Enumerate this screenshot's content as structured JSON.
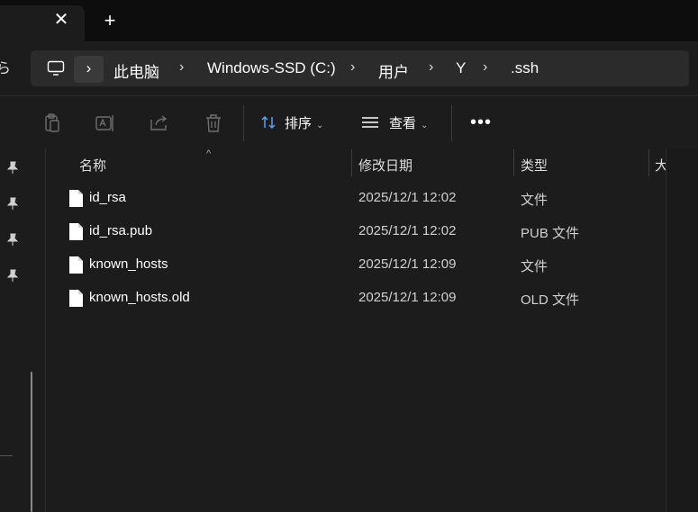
{
  "tab_bar": {
    "close_glyph": "✕",
    "new_tab_glyph": "+"
  },
  "address": {
    "edge_glyph": "ら",
    "chevron_glyph": "›",
    "crumbs": [
      "此电脑",
      "Windows-SSD (C:)",
      "用户",
      "Y",
      ".ssh"
    ]
  },
  "toolbar": {
    "icons": [
      "paste-icon",
      "rename-icon",
      "share-icon",
      "delete-icon"
    ],
    "sort_label": "排序",
    "view_label": "查看",
    "more_label": "•••"
  },
  "nav": {
    "pinned_icons": [
      "pin-icon",
      "pin-icon",
      "pin-icon",
      "pin-icon"
    ]
  },
  "columns": {
    "sort_indicator": "^",
    "name": "名称",
    "date": "修改日期",
    "type": "类型",
    "size_clipped": "大"
  },
  "files": [
    {
      "name": "id_rsa",
      "date": "2025/12/1 12:02",
      "type": "文件"
    },
    {
      "name": "id_rsa.pub",
      "date": "2025/12/1 12:02",
      "type": "PUB 文件"
    },
    {
      "name": "known_hosts",
      "date": "2025/12/1 12:09",
      "type": "文件"
    },
    {
      "name": "known_hosts.old",
      "date": "2025/12/1 12:09",
      "type": "OLD 文件"
    }
  ],
  "colors": {
    "background": "#1c1c1c",
    "tabbar": "#0d0d0d",
    "addressbar": "#2b2b2b",
    "text": "#ffffff"
  }
}
